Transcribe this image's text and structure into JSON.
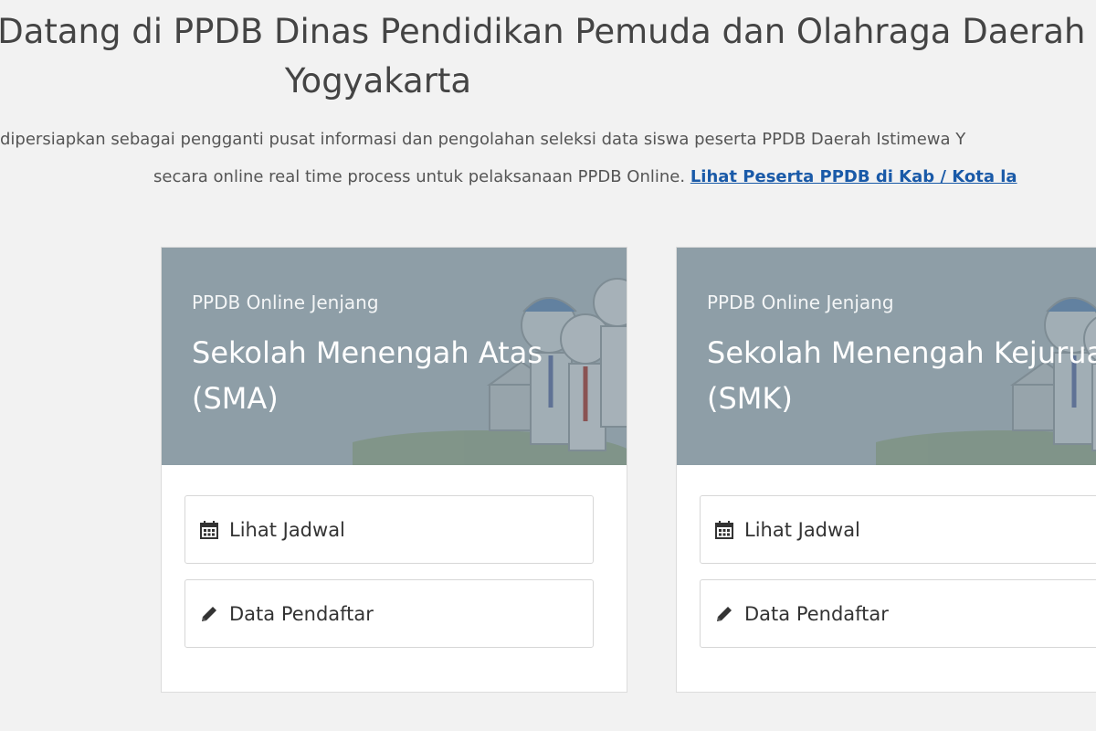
{
  "header": {
    "title_line1": "Selamat Datang di PPDB Dinas Pendidikan Pemuda dan Olahraga Daerah Istimewa",
    "title_line2": "Yogyakarta",
    "desc_line1": "dipersiapkan sebagai pengganti pusat informasi dan pengolahan seleksi data siswa peserta PPDB Daerah Istimewa Y",
    "desc_line2": "secara online real time process untuk pelaksanaan PPDB Online.",
    "desc_link": "Lihat Peserta PPDB di Kab / Kota la"
  },
  "cards": [
    {
      "kicker": "PPDB Online Jenjang",
      "title_line1": "Sekolah Menengah Atas",
      "title_line2": "(SMA)",
      "buttons": [
        {
          "label": "Lihat Jadwal",
          "icon": "calendar-icon"
        },
        {
          "label": "Data Pendaftar",
          "icon": "pencil-icon"
        }
      ]
    },
    {
      "kicker": "PPDB Online Jenjang",
      "title_line1": "Sekolah Menengah Kejuruan",
      "title_line2": "(SMK)",
      "buttons": [
        {
          "label": "Lihat Jadwal",
          "icon": "calendar-icon"
        },
        {
          "label": "Data Pendaftar",
          "icon": "pencil-icon"
        }
      ]
    }
  ],
  "colors": {
    "banner": "#8e9ea7",
    "link": "#1a5aa8",
    "text": "#444444"
  }
}
